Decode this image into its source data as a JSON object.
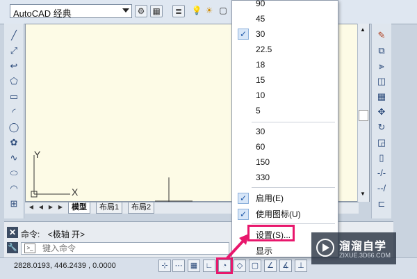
{
  "toolbar": {
    "workspace": "AutoCAD 经典",
    "icons": [
      "gear-icon",
      "workspace-icon",
      "layer-icon",
      "bulb-icon",
      "sun-icon",
      "lock-icon"
    ]
  },
  "layout_tabs": {
    "model": "模型",
    "layout1": "布局1",
    "layout2": "布局2"
  },
  "command": {
    "history_prefix": "命令:",
    "history_text": "<极轴 开>",
    "input_placeholder": "键入命令"
  },
  "status": {
    "coordinates": "2828.0193, 446.2439 , 0.0000"
  },
  "menu": {
    "angles": [
      {
        "label": "90",
        "checked": false
      },
      {
        "label": "45",
        "checked": false
      },
      {
        "label": "30",
        "checked": true
      },
      {
        "label": "22.5",
        "checked": false
      },
      {
        "label": "18",
        "checked": false
      },
      {
        "label": "15",
        "checked": false
      },
      {
        "label": "10",
        "checked": false
      },
      {
        "label": "5",
        "checked": false
      }
    ],
    "extra_angles": [
      "30",
      "60",
      "150",
      "330"
    ],
    "enable": "启用(E)",
    "use_icons": "使用图标(U)",
    "settings": "设置(S)...",
    "display": "显示"
  },
  "watermark": {
    "title": "溜溜自学",
    "url": "ZIXUE.3D66.COM"
  },
  "colors": {
    "highlight": "#e8176c",
    "canvas": "#fdfbe6",
    "check": "#1c56a8"
  }
}
